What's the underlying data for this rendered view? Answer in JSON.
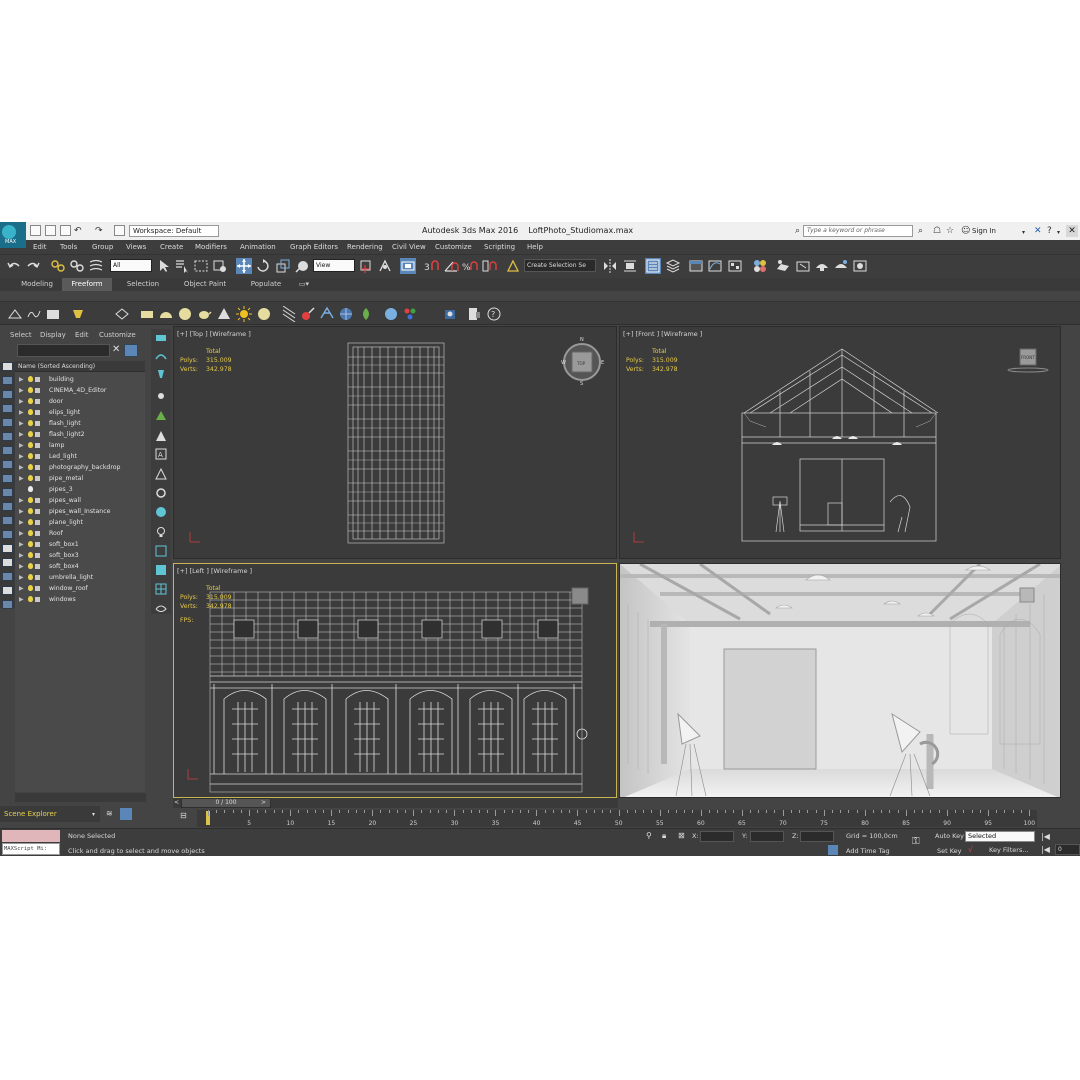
{
  "title_bar": {
    "logo_text": "MAX",
    "workspace": "Workspace: Default",
    "app_title": "Autodesk 3ds Max 2016",
    "file_name": "LoftPhoto_Studiomax.max",
    "search_placeholder": "Type a keyword or phrase",
    "sign_in": "Sign In"
  },
  "menu": [
    "Edit",
    "Tools",
    "Group",
    "Views",
    "Create",
    "Modifiers",
    "Animation",
    "Graph Editors",
    "Rendering",
    "Civil View",
    "Customize",
    "Scripting",
    "Help"
  ],
  "toolbar": {
    "selection_filter": "All",
    "reference_coord": "View",
    "named_selection": "Create Selection Se"
  },
  "ribbon_tabs": [
    "Modeling",
    "Freeform",
    "Selection",
    "Object Paint",
    "Populate"
  ],
  "scene_explorer": {
    "menu": [
      "Select",
      "Display",
      "Edit",
      "Customize"
    ],
    "column_header": "Name (Sorted Ascending)",
    "items": [
      {
        "name": "building",
        "icon": "bulb"
      },
      {
        "name": "CINEMA_4D_Editor",
        "icon": "camera"
      },
      {
        "name": "door",
        "icon": "bulb"
      },
      {
        "name": "elips_light",
        "icon": "bulb"
      },
      {
        "name": "flash_light",
        "icon": "bulb"
      },
      {
        "name": "flash_light2",
        "icon": "bulb"
      },
      {
        "name": "lamp",
        "icon": "bulb"
      },
      {
        "name": "Led_light",
        "icon": "bulb"
      },
      {
        "name": "photography_backdrop",
        "icon": "bulb"
      },
      {
        "name": "pipe_metal",
        "icon": "bulb"
      },
      {
        "name": "pipes_3",
        "icon": "bulb-white"
      },
      {
        "name": "pipes_wall",
        "icon": "bulb"
      },
      {
        "name": "pipes_wall_Instance",
        "icon": "bulb"
      },
      {
        "name": "plane_light",
        "icon": "bulb"
      },
      {
        "name": "Roof",
        "icon": "bulb"
      },
      {
        "name": "soft_box1",
        "icon": "bulb"
      },
      {
        "name": "soft_box3",
        "icon": "bulb"
      },
      {
        "name": "soft_box4",
        "icon": "bulb"
      },
      {
        "name": "umbrella_light",
        "icon": "bulb"
      },
      {
        "name": "window_roof",
        "icon": "bulb"
      },
      {
        "name": "windows",
        "icon": "bulb"
      }
    ],
    "footer_title": "Scene Explorer"
  },
  "viewports": {
    "top": {
      "label": "[+] [Top ] [Wireframe ]",
      "total": "Total",
      "polys_key": "Polys:",
      "polys": "315.009",
      "verts_key": "Verts:",
      "verts": "342.978",
      "compass": [
        "N",
        "W",
        "E",
        "S"
      ],
      "cube_label": "TOP"
    },
    "front": {
      "label": "[+] [Front ] [Wireframe ]",
      "total": "Total",
      "polys_key": "Polys:",
      "polys": "315.009",
      "verts_key": "Verts:",
      "verts": "342.978",
      "cube_label": "FRONT"
    },
    "left": {
      "label": "[+] [Left ] [Wireframe ]",
      "total": "Total",
      "polys_key": "Polys:",
      "polys": "315.009",
      "verts_key": "Verts:",
      "verts": "342.978",
      "fps_key": "FPS:"
    },
    "persp": {
      "label": ""
    }
  },
  "timeline": {
    "frame_counter": "0 / 100",
    "ticks": [
      "5",
      "10",
      "15",
      "20",
      "25",
      "30",
      "35",
      "40",
      "45",
      "50",
      "55",
      "60",
      "65",
      "70",
      "75",
      "80",
      "85",
      "90",
      "95",
      "100"
    ]
  },
  "status": {
    "maxscript": "MAXScript Mi:",
    "selection": "None Selected",
    "prompt": "Click and drag to select and move objects",
    "x_label": "X:",
    "y_label": "Y:",
    "z_label": "Z:",
    "grid": "Grid = 100,0cm",
    "add_time_tag": "Add Time Tag",
    "auto_key": "Auto Key",
    "set_key": "Set Key",
    "selected": "Selected",
    "key_filters": "Key Filters...",
    "frame": "0"
  },
  "colors": {
    "ui_bg": "#444444",
    "stats": "#e5c94a",
    "active_border": "#c9b455",
    "accent_blue": "#5b86b8"
  }
}
